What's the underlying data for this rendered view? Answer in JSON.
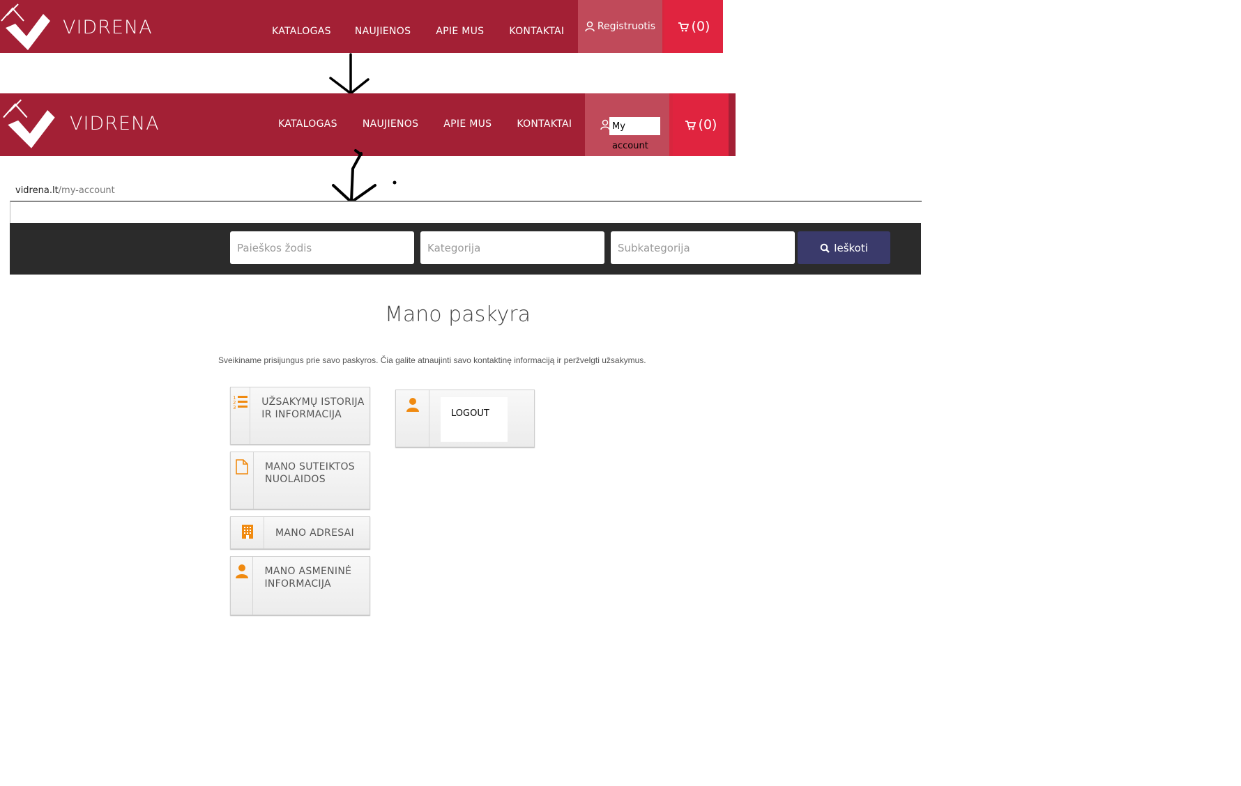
{
  "header_old": {
    "brand": "VIDRENA",
    "nav": [
      "KATALOGAS",
      "NAUJIENOS",
      "APIE MUS",
      "KONTAKTAI"
    ],
    "register_label": "Registruotis",
    "cart_label": "(0)"
  },
  "header_new": {
    "brand": "VIDRENA",
    "nav": [
      "KATALOGAS",
      "NAUJIENOS",
      "APIE MUS",
      "KONTAKTAI"
    ],
    "account_label": "My account",
    "cart_label": "(0)"
  },
  "url": {
    "domain": "vidrena.lt",
    "path": "/my-account"
  },
  "search": {
    "keyword_placeholder": "Paieškos žodis",
    "category_placeholder": "Kategorija",
    "subcategory_placeholder": "Subkategorija",
    "button_label": "Ieškoti"
  },
  "page": {
    "title": "Mano paskyra",
    "welcome": "Sveikiname prisijungus prie savo paskyros. Čia galite atnaujinti savo kontaktinę informaciją ir peržvelgti užsakymus.",
    "tiles": [
      {
        "label": "Užsakymų istorija ir informacija",
        "icon": "list-ordered-icon"
      },
      {
        "label": "Mano suteiktos nuolaidos",
        "icon": "document-icon"
      },
      {
        "label": "Mano adresai",
        "icon": "building-icon"
      },
      {
        "label": "Mano asmeninė informacija",
        "icon": "user-icon"
      }
    ],
    "logout_label": "LOGOUT"
  },
  "colors": {
    "header": "#a32035",
    "cart": "#e0243f",
    "search_bg": "#2b2b2b",
    "search_button": "#3a3a6b",
    "icon_accent": "#f08a10"
  }
}
